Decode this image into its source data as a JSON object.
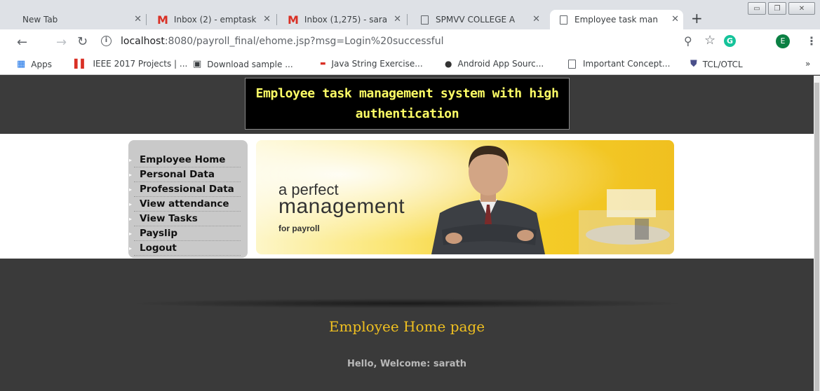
{
  "tabs": [
    {
      "title": "New Tab"
    },
    {
      "title": "Inbox (2) - emptask"
    },
    {
      "title": "Inbox (1,275) - sara"
    },
    {
      "title": "SPMVV COLLEGE A"
    },
    {
      "title": "Employee task man"
    }
  ],
  "address": {
    "host": "localhost",
    "path": ":8080/payroll_final/ehome.jsp?msg=Login%20successful"
  },
  "profile_initial": "E",
  "grammarly_label": "G",
  "bookmarks": [
    {
      "label": "Apps"
    },
    {
      "label": "IEEE 2017 Projects | ..."
    },
    {
      "label": "Download sample ..."
    },
    {
      "label": "Java String Exercise..."
    },
    {
      "label": "Android App Sourc..."
    },
    {
      "label": "Important Concept..."
    },
    {
      "label": "TCL/OTCL"
    }
  ],
  "site": {
    "title": "Employee task management system with high authentication"
  },
  "menu": [
    {
      "label": "Employee Home"
    },
    {
      "label": "Personal Data"
    },
    {
      "label": "Professional Data"
    },
    {
      "label": "View attendance"
    },
    {
      "label": "View Tasks"
    },
    {
      "label": "Payslip"
    },
    {
      "label": "Logout"
    }
  ],
  "banner": {
    "line1": "a perfect",
    "line2": "management",
    "line3": "for payroll"
  },
  "main": {
    "heading": "Employee Home page",
    "welcome": "Hello, Welcome: sarath"
  },
  "colors": {
    "heading": "#f0c020",
    "title_text": "#ffff66",
    "gmail": "#d93025"
  }
}
